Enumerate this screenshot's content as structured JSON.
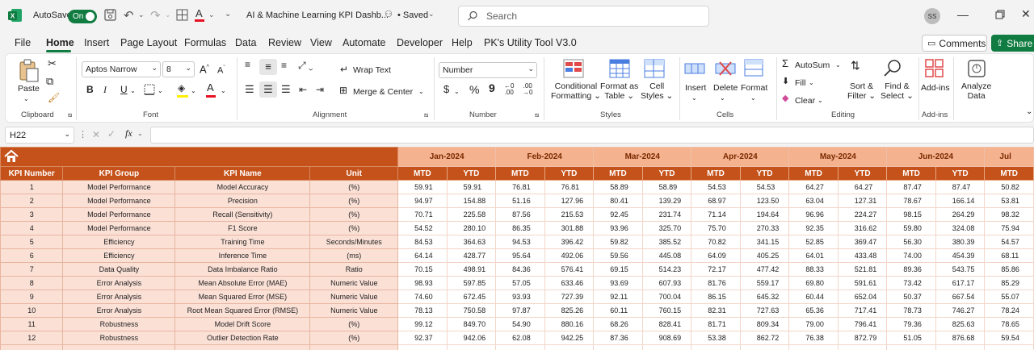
{
  "titlebar": {
    "autosave_label": "AutoSave",
    "autosave_state": "On",
    "filename": "AI & Machine Learning KPI Dashb...",
    "saved": "• Saved",
    "search_placeholder": "Search",
    "avatar": "SS"
  },
  "menu": [
    "File",
    "Home",
    "Insert",
    "Page Layout",
    "Formulas",
    "Data",
    "Review",
    "View",
    "Automate",
    "Developer",
    "Help",
    "PK's Utility Tool V3.0"
  ],
  "menu_active": "Home",
  "comments_label": "Comments",
  "share_label": "Share",
  "ribbon": {
    "paste": "Paste",
    "clipboard": "Clipboard",
    "font_name": "Aptos Narrow",
    "font_size": "8",
    "font": "Font",
    "wrap_text": "Wrap Text",
    "merge_center": "Merge & Center",
    "alignment": "Alignment",
    "number_format": "Number",
    "number": "Number",
    "cond_format_1": "Conditional",
    "cond_format_2": "Formatting",
    "format_table_1": "Format as",
    "format_table_2": "Table",
    "cell_styles_1": "Cell",
    "cell_styles_2": "Styles",
    "styles": "Styles",
    "insert": "Insert",
    "delete": "Delete",
    "format": "Format",
    "cells": "Cells",
    "autosum": "AutoSum",
    "fill": "Fill",
    "clear": "Clear",
    "sort_1": "Sort &",
    "sort_2": "Filter",
    "find_1": "Find &",
    "find_2": "Select",
    "editing": "Editing",
    "addins": "Add-ins",
    "addins_group": "Add-ins",
    "analyze_1": "Analyze",
    "analyze_2": "Data"
  },
  "formula_bar": {
    "cell_ref": "H22",
    "fx": "fx",
    "content": ""
  },
  "sheet": {
    "headers": [
      "KPI Number",
      "KPI Group",
      "KPI Name",
      "Unit"
    ],
    "months": [
      "Jan-2024",
      "Feb-2024",
      "Mar-2024",
      "Apr-2024",
      "May-2024",
      "Jun-2024",
      "Jul"
    ],
    "sub": [
      "MTD",
      "YTD"
    ],
    "rows": [
      [
        "1",
        "Model Performance",
        "Model Accuracy",
        "(%)",
        "59.91",
        "59.91",
        "76.81",
        "76.81",
        "58.89",
        "58.89",
        "54.53",
        "54.53",
        "64.27",
        "64.27",
        "87.47",
        "87.47",
        "50.82"
      ],
      [
        "2",
        "Model Performance",
        "Precision",
        "(%)",
        "94.97",
        "154.88",
        "51.16",
        "127.96",
        "80.41",
        "139.29",
        "68.97",
        "123.50",
        "63.04",
        "127.31",
        "78.67",
        "166.14",
        "53.81"
      ],
      [
        "3",
        "Model Performance",
        "Recall (Sensitivity)",
        "(%)",
        "70.71",
        "225.58",
        "87.56",
        "215.53",
        "92.45",
        "231.74",
        "71.14",
        "194.64",
        "96.96",
        "224.27",
        "98.15",
        "264.29",
        "98.32"
      ],
      [
        "4",
        "Model Performance",
        "F1 Score",
        "(%)",
        "54.52",
        "280.10",
        "86.35",
        "301.88",
        "93.96",
        "325.70",
        "75.70",
        "270.33",
        "92.35",
        "316.62",
        "59.80",
        "324.08",
        "75.94"
      ],
      [
        "5",
        "Efficiency",
        "Training Time",
        "Seconds/Minutes",
        "84.53",
        "364.63",
        "94.53",
        "396.42",
        "59.82",
        "385.52",
        "70.82",
        "341.15",
        "52.85",
        "369.47",
        "56.30",
        "380.39",
        "54.57"
      ],
      [
        "6",
        "Efficiency",
        "Inference Time",
        "(ms)",
        "64.14",
        "428.77",
        "95.64",
        "492.06",
        "59.56",
        "445.08",
        "64.09",
        "405.25",
        "64.01",
        "433.48",
        "74.00",
        "454.39",
        "68.11"
      ],
      [
        "7",
        "Data Quality",
        "Data Imbalance Ratio",
        "Ratio",
        "70.15",
        "498.91",
        "84.36",
        "576.41",
        "69.15",
        "514.23",
        "72.17",
        "477.42",
        "88.33",
        "521.81",
        "89.36",
        "543.75",
        "85.86"
      ],
      [
        "8",
        "Error Analysis",
        "Mean Absolute Error (MAE)",
        "Numeric Value",
        "98.93",
        "597.85",
        "57.05",
        "633.46",
        "93.69",
        "607.93",
        "81.76",
        "559.17",
        "69.80",
        "591.61",
        "73.42",
        "617.17",
        "85.29"
      ],
      [
        "9",
        "Error Analysis",
        "Mean Squared Error (MSE)",
        "Numeric Value",
        "74.60",
        "672.45",
        "93.93",
        "727.39",
        "92.11",
        "700.04",
        "86.15",
        "645.32",
        "60.44",
        "652.04",
        "50.37",
        "667.54",
        "55.07"
      ],
      [
        "10",
        "Error Analysis",
        "Root Mean Squared Error (RMSE)",
        "Numeric Value",
        "78.13",
        "750.58",
        "97.87",
        "825.26",
        "60.11",
        "760.15",
        "82.31",
        "727.63",
        "65.36",
        "717.41",
        "78.73",
        "746.27",
        "78.24"
      ],
      [
        "11",
        "Robustness",
        "Model Drift Score",
        "(%)",
        "99.12",
        "849.70",
        "54.90",
        "880.16",
        "68.26",
        "828.41",
        "81.71",
        "809.34",
        "79.00",
        "796.41",
        "79.36",
        "825.63",
        "78.65"
      ],
      [
        "12",
        "Robustness",
        "Outlier Detection Rate",
        "(%)",
        "92.37",
        "942.06",
        "62.08",
        "942.25",
        "87.36",
        "908.69",
        "53.38",
        "862.72",
        "76.38",
        "872.79",
        "51.05",
        "876.68",
        "59.54"
      ]
    ]
  }
}
